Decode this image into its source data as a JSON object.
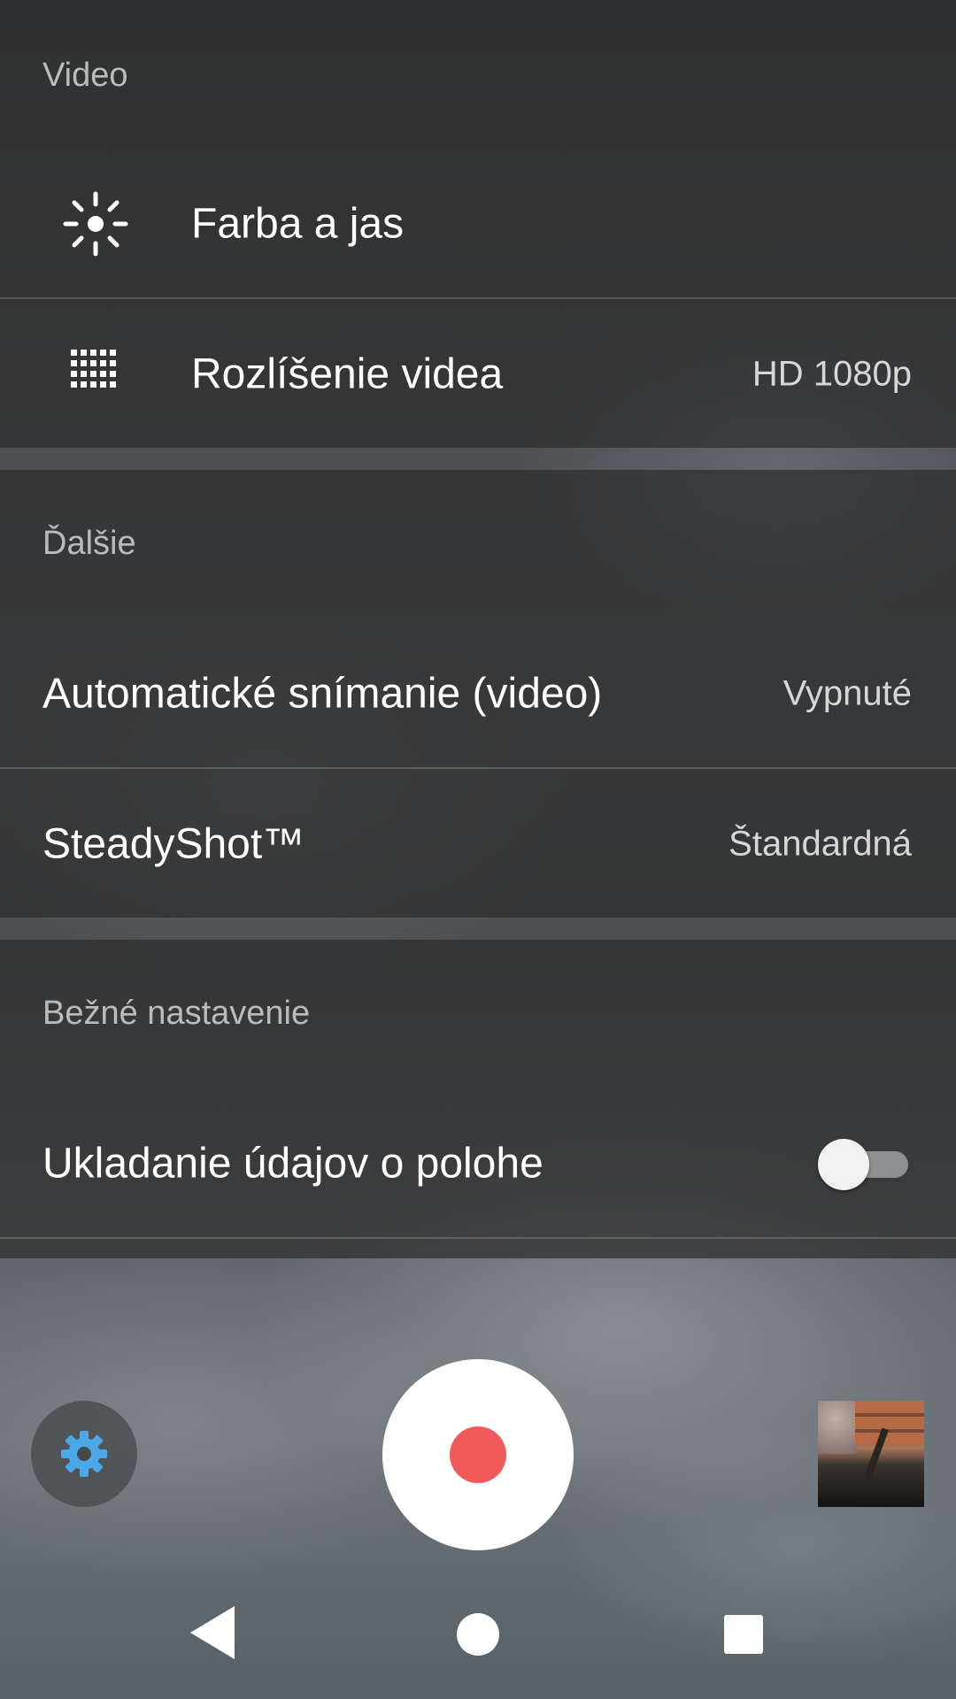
{
  "sections": {
    "video": {
      "title": "Video",
      "rows": [
        {
          "label": "Farba a jas",
          "icon": "brightness-icon"
        },
        {
          "label": "Rozlíšenie videa",
          "value": "HD 1080p",
          "icon": "resolution-grid-icon"
        }
      ]
    },
    "more": {
      "title": "Ďalšie",
      "rows": [
        {
          "label": "Automatické snímanie (video)",
          "value": "Vypnuté"
        },
        {
          "label": "SteadyShot™",
          "value": "Štandardná"
        }
      ]
    },
    "common": {
      "title": "Bežné nastavenie",
      "rows": [
        {
          "label": "Ukladanie údajov o polohe",
          "toggle_on": false
        }
      ]
    }
  },
  "controls": {
    "settings_icon": "gear-icon",
    "record_icon": "record-icon",
    "thumbnail": "last-capture-thumbnail",
    "accent_color": "#4aa8e8",
    "record_color": "#f25a5a"
  },
  "navigation": {
    "back_icon": "back-icon",
    "home_icon": "home-icon",
    "recents_icon": "recents-icon"
  }
}
